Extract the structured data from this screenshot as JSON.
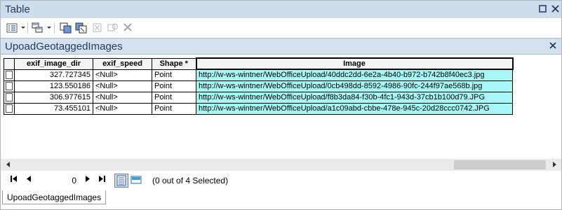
{
  "window": {
    "title": "Table"
  },
  "table_tab": {
    "name": "UpoadGeotaggedImages"
  },
  "columns": [
    {
      "label": "exif_image_dir"
    },
    {
      "label": "exif_speed"
    },
    {
      "label": "Shape *"
    },
    {
      "label": "Image"
    }
  ],
  "rows": [
    {
      "exif_image_dir": "327.727345",
      "exif_speed": "<Null>",
      "shape": "Point",
      "image": "http://w-ws-wintner/WebOfficeUpload/40ddc2dd-6e2a-4b40-b972-b742b8f40ec3.jpg"
    },
    {
      "exif_image_dir": "123.550186",
      "exif_speed": "<Null>",
      "shape": "Point",
      "image": "http://w-ws-wintner/WebOfficeUpload/0cb498dd-8592-4986-90fc-244f97ae568b.jpg"
    },
    {
      "exif_image_dir": "306.977615",
      "exif_speed": "<Null>",
      "shape": "Point",
      "image": "http://w-ws-wintner/WebOfficeUpload/f8b3da84-f30b-4fc1-943d-37cb1b100d79.JPG"
    },
    {
      "exif_image_dir": "73.455101",
      "exif_speed": "<Null>",
      "shape": "Point",
      "image": "http://w-ws-wintner/WebOfficeUpload/a1c09abd-cbbe-478e-945c-20d28ccc0742.JPG"
    }
  ],
  "navigation": {
    "current_record": "0"
  },
  "status": {
    "selection_text": "(0 out of 4 Selected)"
  },
  "bottom_tabs": [
    {
      "label": "UpoadGeotaggedImages"
    }
  ],
  "colors": {
    "image_cell": "#a7f7f7",
    "title_bar": "#cfdcec",
    "title_text": "#1e395b"
  }
}
